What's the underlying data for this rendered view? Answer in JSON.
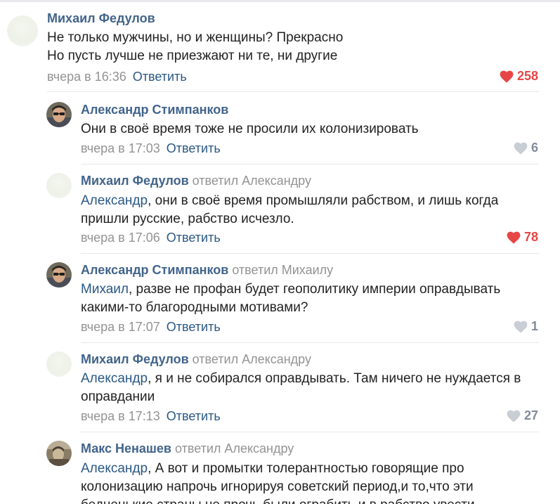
{
  "comments": [
    {
      "author": "Михаил Федулов",
      "replied_to": "",
      "mention": "",
      "text_lines": [
        "Не только мужчины, но и женщины? Прекрасно",
        "Но пусть лучше не приезжают ни те, ни другие"
      ],
      "time": "вчера в 16:36",
      "reply_label": "Ответить",
      "likes": "258",
      "liked": true
    },
    {
      "author": "Александр Стимпанков",
      "replied_to": "",
      "mention": "",
      "text_lines": [
        "Они в своё время тоже не просили их колонизировать"
      ],
      "time": "вчера в 17:03",
      "reply_label": "Ответить",
      "likes": "6",
      "liked": false
    },
    {
      "author": "Михаил Федулов",
      "replied_to": "ответил Александру",
      "mention": "Александр",
      "text_lines": [
        ", они в своё время промышляли рабством, и лишь когда",
        "пришли русские, рабство исчезло."
      ],
      "time": "вчера в 17:06",
      "reply_label": "Ответить",
      "likes": "78",
      "liked": true
    },
    {
      "author": "Александр Стимпанков",
      "replied_to": "ответил Михаилу",
      "mention": "Михаил",
      "text_lines": [
        ", разве не профан будет геополитику империи оправдывать",
        "какими-то благородными мотивами?"
      ],
      "time": "вчера в 17:07",
      "reply_label": "Ответить",
      "likes": "1",
      "liked": false
    },
    {
      "author": "Михаил Федулов",
      "replied_to": "ответил Александру",
      "mention": "Александр",
      "text_lines": [
        ", я и не собирался оправдывать. Там ничего не нуждается в",
        "оправдании"
      ],
      "time": "вчера в 17:13",
      "reply_label": "Ответить",
      "likes": "27",
      "liked": false
    },
    {
      "author": "Макс Ненашев",
      "replied_to": "ответил Александру",
      "mention": "Александр",
      "text_lines": [
        ", А вот и промытки толерантностью говорящие про",
        "колонизацию напрочь игнорируя советский период,и то,что эти",
        "бедненькие страны не прочь были ограбить и в рабство увести"
      ],
      "time": "",
      "reply_label": "",
      "likes": "",
      "liked": false
    }
  ],
  "colors": {
    "author": "#42648b",
    "link": "#2a5885",
    "meta": "#939393",
    "like_active": "#e64646",
    "like_inactive": "#828a99"
  }
}
